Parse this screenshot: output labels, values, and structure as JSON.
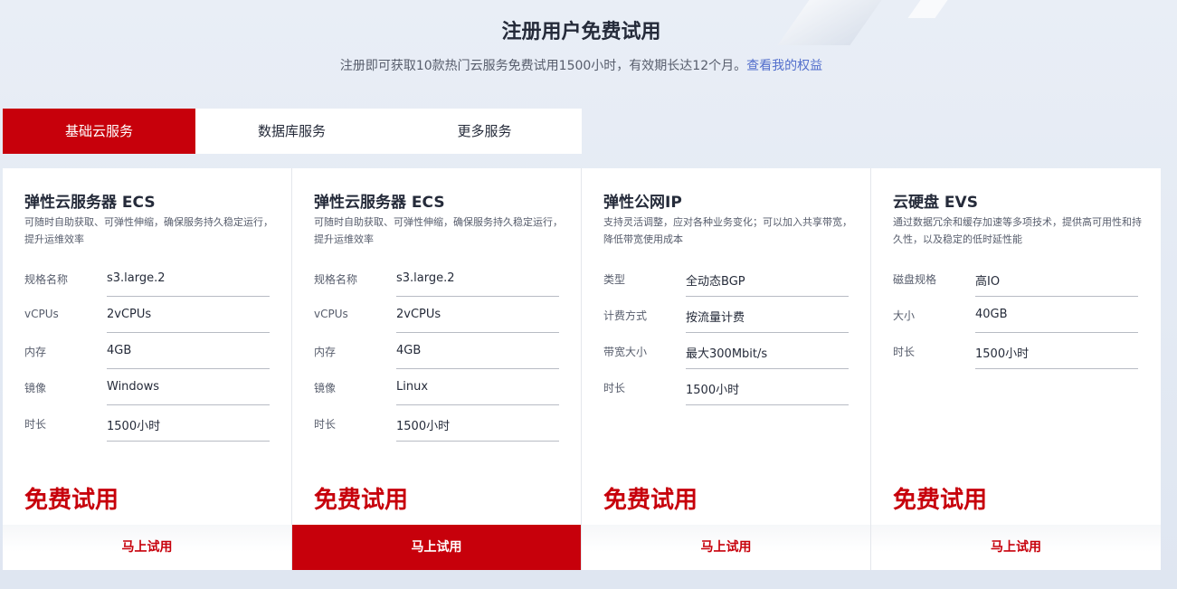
{
  "header": {
    "title": "注册用户免费试用",
    "subtitle": "注册即可获取10款热门云服务免费试用1500小时，有效期长达12个月。",
    "link": "查看我的权益"
  },
  "tabs": [
    {
      "label": "基础云服务",
      "active": true
    },
    {
      "label": "数据库服务",
      "active": false
    },
    {
      "label": "更多服务",
      "active": false
    }
  ],
  "cards": [
    {
      "title": "弹性云服务器 ECS",
      "desc": "可随时自助获取、可弹性伸缩，确保服务持久稳定运行，提升运维效率",
      "specs": [
        {
          "label": "规格名称",
          "value": "s3.large.2"
        },
        {
          "label": "vCPUs",
          "value": "2vCPUs"
        },
        {
          "label": "内存",
          "value": "4GB"
        },
        {
          "label": "镜像",
          "value": "Windows"
        },
        {
          "label": "时长",
          "value": "1500小时"
        }
      ],
      "free": "免费试用",
      "button": "马上试用"
    },
    {
      "title": "弹性云服务器 ECS",
      "desc": "可随时自助获取、可弹性伸缩，确保服务持久稳定运行，提升运维效率",
      "specs": [
        {
          "label": "规格名称",
          "value": "s3.large.2"
        },
        {
          "label": "vCPUs",
          "value": "2vCPUs"
        },
        {
          "label": "内存",
          "value": "4GB"
        },
        {
          "label": "镜像",
          "value": "Linux"
        },
        {
          "label": "时长",
          "value": "1500小时"
        }
      ],
      "free": "免费试用",
      "button": "马上试用"
    },
    {
      "title": "弹性公网IP",
      "desc": "支持灵活调整，应对各种业务变化；可以加入共享带宽，降低带宽使用成本",
      "specs": [
        {
          "label": "类型",
          "value": "全动态BGP"
        },
        {
          "label": "计费方式",
          "value": "按流量计费"
        },
        {
          "label": "带宽大小",
          "value": "最大300Mbit/s"
        },
        {
          "label": "时长",
          "value": "1500小时"
        }
      ],
      "free": "免费试用",
      "button": "马上试用"
    },
    {
      "title": "云硬盘 EVS",
      "desc": "通过数据冗余和缓存加速等多项技术，提供高可用性和持久性，以及稳定的低时延性能",
      "specs": [
        {
          "label": "磁盘规格",
          "value": "高IO"
        },
        {
          "label": "大小",
          "value": "40GB"
        },
        {
          "label": "时长",
          "value": "1500小时"
        }
      ],
      "free": "免费试用",
      "button": "马上试用"
    }
  ],
  "colors": {
    "accent": "#c7000b",
    "link": "#526ecc",
    "text": "#252b3a"
  }
}
